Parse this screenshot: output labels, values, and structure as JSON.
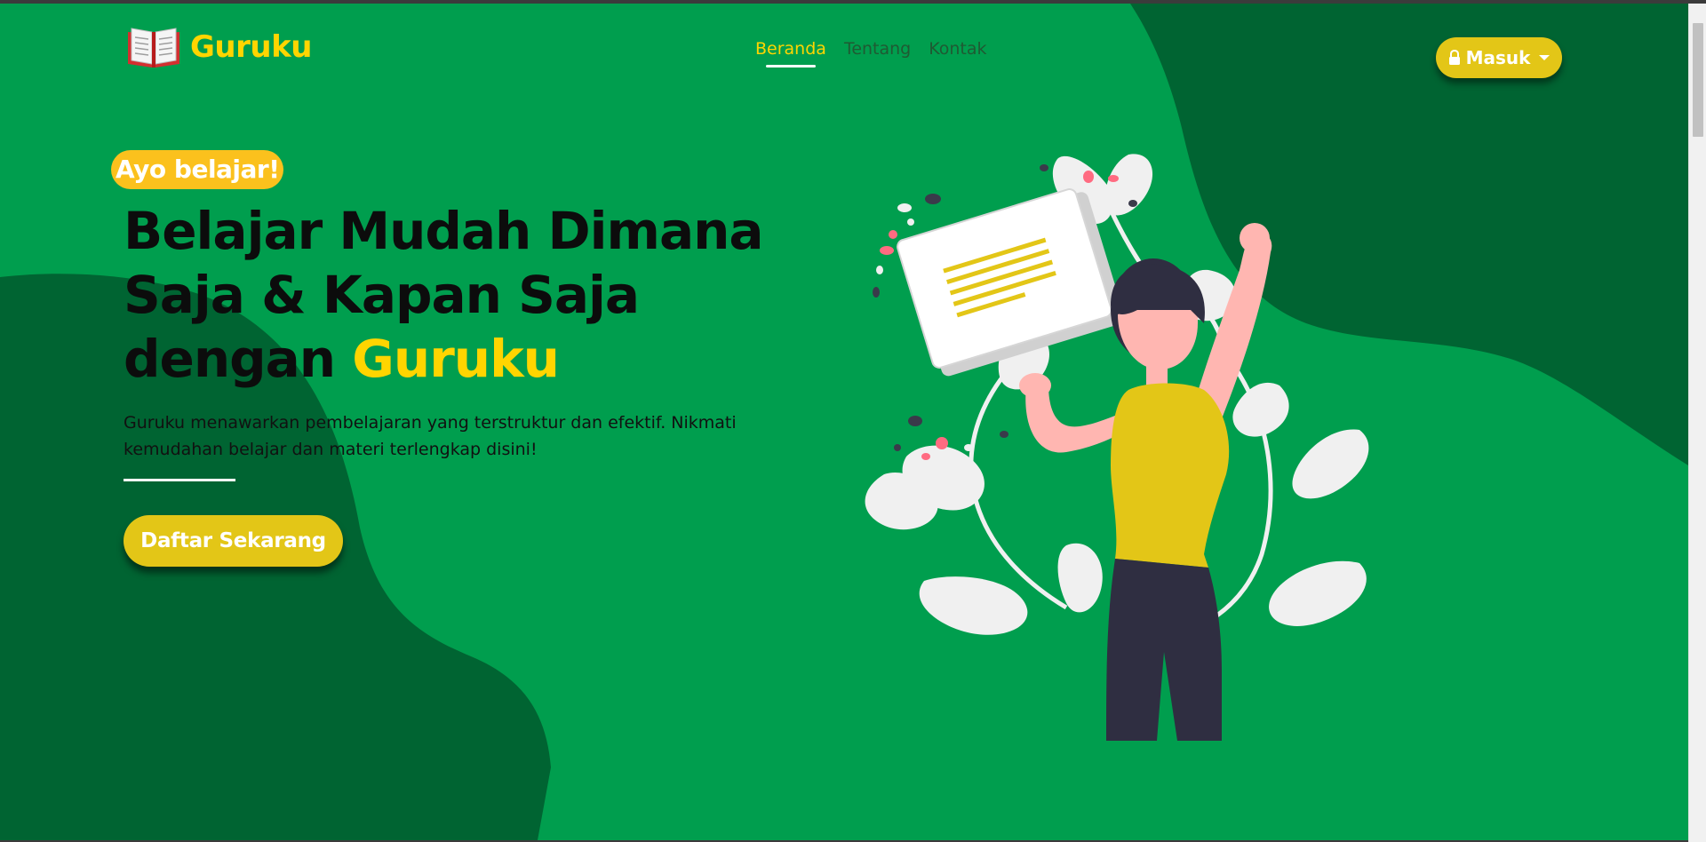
{
  "brand": {
    "name": "Guruku",
    "icon": "open-book-icon"
  },
  "nav": {
    "items": [
      {
        "label": "Beranda",
        "active": true
      },
      {
        "label": "Tentang",
        "active": false
      },
      {
        "label": "Kontak",
        "active": false
      }
    ],
    "login_label": "Masuk",
    "login_icon": "lock-icon"
  },
  "hero": {
    "badge": "Ayo belajar!",
    "title_line1": "Belajar Mudah Dimana",
    "title_line2": "Saja & Kapan Saja",
    "title_line3_prefix": "dengan ",
    "title_line3_accent": "Guruku",
    "description_line1": "Guruku menawarkan pembelajaran yang terstruktur dan efektif. Nikmati",
    "description_line2": "kemudahan belajar dan materi terlengkap disini!",
    "cta_label": "Daftar Sekarang"
  },
  "colors": {
    "primary_green": "#009e4e",
    "dark_green": "#006432",
    "accent_yellow": "#ffd500",
    "button_yellow": "#e3c617",
    "badge_yellow": "#fbc11d"
  }
}
